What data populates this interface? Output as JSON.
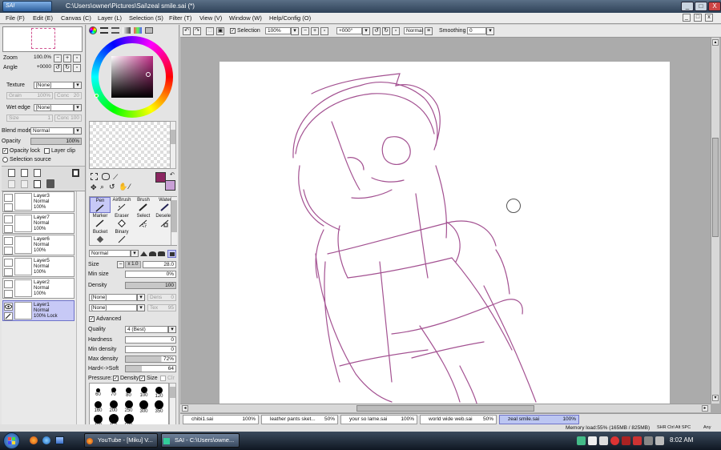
{
  "window": {
    "app_logo": "SAI",
    "title": "C:\\Users\\owner\\Pictures\\Sai\\zeal smile.sai (*)",
    "minimize": "_",
    "restore": "□",
    "close": "X"
  },
  "menu": [
    {
      "label": "File (F)"
    },
    {
      "label": "Edit (E)"
    },
    {
      "label": "Canvas (C)"
    },
    {
      "label": "Layer (L)"
    },
    {
      "label": "Selection (S)"
    },
    {
      "label": "Filter (T)"
    },
    {
      "label": "View (V)"
    },
    {
      "label": "Window (W)"
    },
    {
      "label": "Help/Config (O)"
    }
  ],
  "navigator": {
    "zoom_label": "Zoom",
    "zoom_value": "100.0%",
    "angle_label": "Angle",
    "angle_value": "+0000"
  },
  "layer_props": {
    "texture_label": "Texture",
    "texture_value": "[None]",
    "grain_label": "Grain",
    "grain_value": "100%",
    "conc_label": "Conc",
    "conc_value": "20",
    "wet_edge_label": "Wet edge",
    "wet_edge_value": "[None]",
    "size_label": "Size",
    "size_value": "1",
    "conc2_value": "100",
    "blend_mode_label": "Blend mode",
    "blend_mode_value": "Normal",
    "opacity_label": "Opacity",
    "opacity_value": "100%",
    "opacity_lock": "Opacity lock",
    "layer_clip": "Layer clip",
    "selection_source": "Selection source"
  },
  "layers": [
    {
      "name": "Layer3",
      "mode": "Normal",
      "opacity": "100%"
    },
    {
      "name": "Layer7",
      "mode": "Normal",
      "opacity": "100%"
    },
    {
      "name": "Layer6",
      "mode": "Normal",
      "opacity": "100%"
    },
    {
      "name": "Layer5",
      "mode": "Normal",
      "opacity": "100%"
    },
    {
      "name": "Layer2",
      "mode": "Normal",
      "opacity": "100%"
    },
    {
      "name": "Layer1",
      "mode": "Normal",
      "opacity": "100% Lock"
    }
  ],
  "tools": {
    "items": [
      {
        "label": "Pen"
      },
      {
        "label": "AirBrush"
      },
      {
        "label": "Brush"
      },
      {
        "label": "Water"
      },
      {
        "label": "Marker"
      },
      {
        "label": "Eraser"
      },
      {
        "label": "Select"
      },
      {
        "label": "Deselect"
      },
      {
        "label": "Bucket"
      },
      {
        "label": "Binary"
      }
    ]
  },
  "brush": {
    "mode": "Normal",
    "size_label": "Size",
    "size_mult": "x 1.0",
    "size_value": "28.0",
    "min_size_label": "Min size",
    "min_size_value": "0%",
    "density_label": "Density",
    "density_value": "100",
    "tex1": "[None]",
    "tex2": "[None]",
    "dens_label": "Dens",
    "dens_value": "0",
    "tex_label": "Tex",
    "tex_value": "95",
    "advanced": "Advanced",
    "quality_label": "Quality",
    "quality_value": "4 (Best)",
    "hardness_label": "Hardness",
    "hardness_value": "0",
    "min_density_label": "Min density",
    "min_density_value": "0",
    "max_density_label": "Max density",
    "max_density_value": "72%",
    "hard_soft_label": "Hard<->Soft",
    "hard_soft_value": "64",
    "pressure_label": "Pressure:",
    "pressure_density": "Density",
    "pressure_size": "Size",
    "pressure_clr": "Clr",
    "sizes": [
      {
        "v": "60",
        "d": 5
      },
      {
        "v": "70",
        "d": 6
      },
      {
        "v": "80",
        "d": 7
      },
      {
        "v": "100",
        "d": 8
      },
      {
        "v": "120",
        "d": 9
      },
      {
        "v": "160",
        "d": 9
      },
      {
        "v": "200",
        "d": 10
      },
      {
        "v": "250",
        "d": 10
      },
      {
        "v": "300",
        "d": 11
      },
      {
        "v": "350",
        "d": 11
      },
      {
        "v": "400",
        "d": 11
      },
      {
        "v": "450",
        "d": 12
      },
      {
        "v": "500",
        "d": 12
      }
    ]
  },
  "canvas_toolbar": {
    "selection": "Selection",
    "zoom": "100%",
    "angle": "+000°",
    "mode": "Normal",
    "smoothing_label": "Smoothing",
    "smoothing_value": "0"
  },
  "tabs": [
    {
      "name": "chibi1.sai",
      "pct": "100%"
    },
    {
      "name": "leather pants sket...",
      "pct": "50%"
    },
    {
      "name": "your so lame.sai",
      "pct": "100%"
    },
    {
      "name": "world wide web.sai",
      "pct": "50%"
    },
    {
      "name": "zeal smile.sai",
      "pct": "100%"
    }
  ],
  "status": {
    "memory": "Memory load:55% (165MB / 825MB)",
    "keys": "SHR Ctrl Alt SPC",
    "any": "Any"
  },
  "taskbar": {
    "items": [
      {
        "label": "YouTube - [Miku] V..."
      },
      {
        "label": "SAI - C:\\Users\\owne..."
      }
    ],
    "clock": "8:02 AM"
  },
  "colors": {
    "primary": "#8b2560",
    "secondary": "#c9a0d6",
    "sketch": "#9a3f86",
    "active_tab": "#bcc6f2"
  }
}
